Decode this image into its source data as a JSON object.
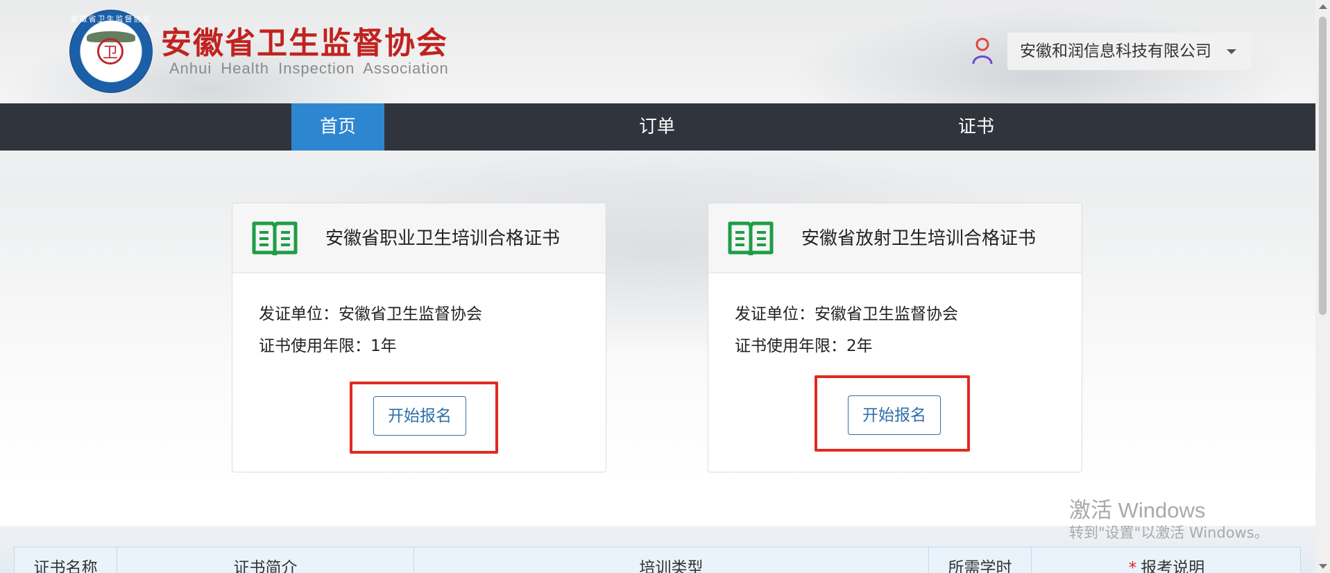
{
  "header": {
    "logo_ring_text": "安徽省卫生监督协会",
    "logo_emblem": "卫",
    "title_cn": "安徽省卫生监督协会",
    "title_en": "Anhui Health Inspection Association",
    "company": "安徽和润信息科技有限公司",
    "user_icon": "user-icon"
  },
  "nav": {
    "items": [
      {
        "label": "首页",
        "active": true
      },
      {
        "label": "订单",
        "active": false
      },
      {
        "label": "证书",
        "active": false
      }
    ]
  },
  "cards": [
    {
      "title": "安徽省职业卫生培训合格证书",
      "issuer_label": "发证单位：",
      "issuer_value": "安徽省卫生监督协会",
      "validity_label": "证书使用年限：",
      "validity_value": "1年",
      "button_label": "开始报名",
      "icon": "book-icon"
    },
    {
      "title": "安徽省放射卫生培训合格证书",
      "issuer_label": "发证单位：",
      "issuer_value": "安徽省卫生监督协会",
      "validity_label": "证书使用年限：",
      "validity_value": "2年",
      "button_label": "开始报名",
      "icon": "book-icon"
    }
  ],
  "table": {
    "columns": [
      "证书名称",
      "证书简介",
      "培训类型",
      "所需学时",
      "报考说明"
    ],
    "required_mark": "*"
  },
  "watermark": {
    "line1": "激活 Windows",
    "line2": "转到\"设置\"以激活 Windows。"
  },
  "colors": {
    "brand_red": "#c0231f",
    "nav_bg": "#30343c",
    "nav_active": "#2f86d0",
    "icon_green": "#1e9d46",
    "button_blue": "#2f6fa8",
    "highlight_red": "#e02a20"
  }
}
